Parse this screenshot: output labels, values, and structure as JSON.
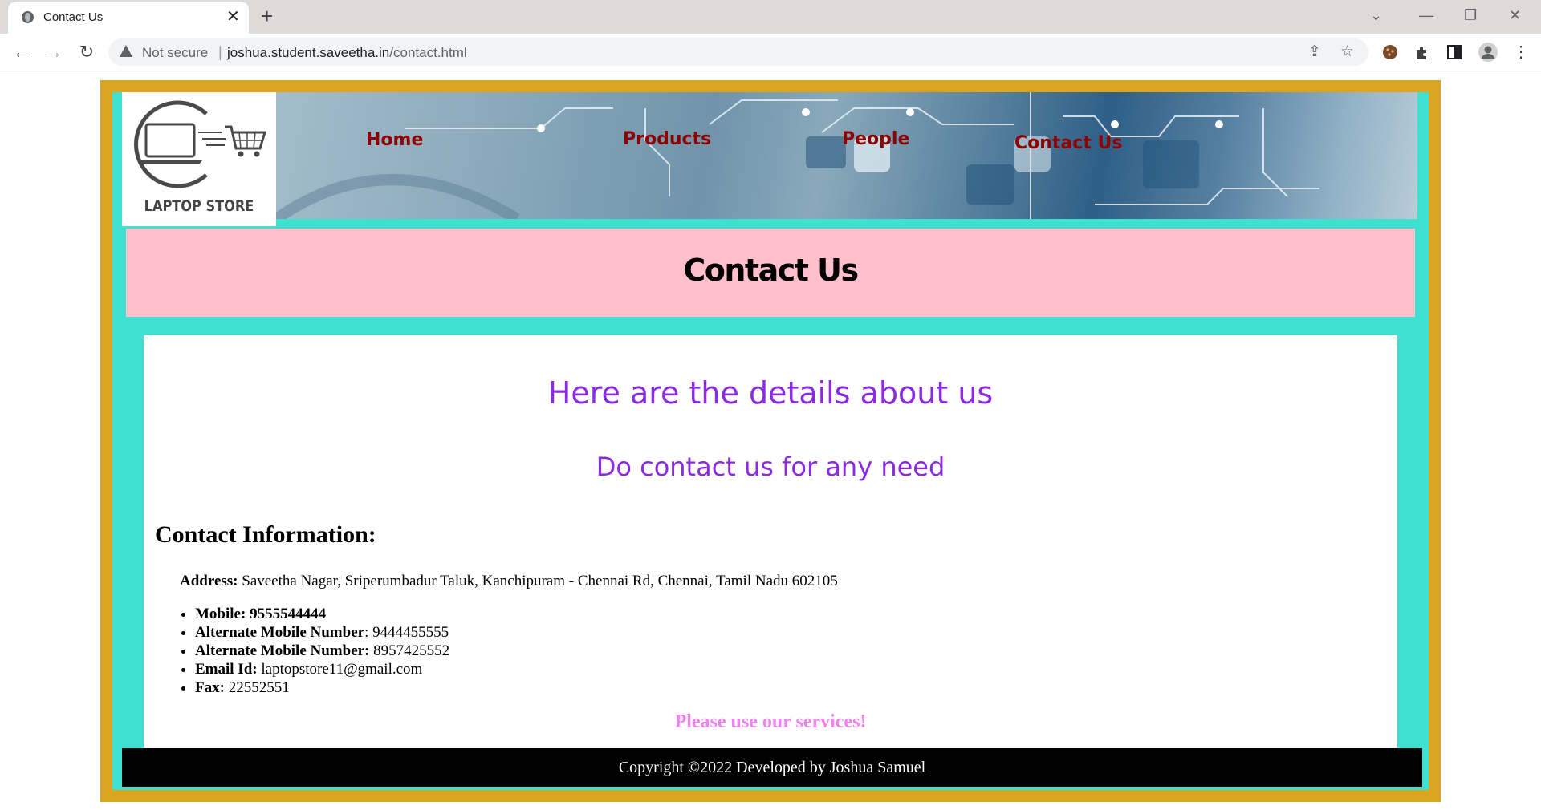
{
  "browser": {
    "tab_title": "Contact Us",
    "security_label": "Not secure",
    "url_host": "joshua.student.saveetha.in",
    "url_path": "/contact.html"
  },
  "site": {
    "logo_text": "LAPTOP STORE",
    "nav": [
      {
        "label": "Home"
      },
      {
        "label": "Products"
      },
      {
        "label": "People"
      },
      {
        "label": "Contact Us"
      }
    ],
    "page_title": "Contact Us",
    "heading": "Here are the details about us",
    "subheading": "Do contact us for any need",
    "contact_info_title": "Contact Information:",
    "address_label": "Address:",
    "address_value": " Saveetha Nagar, Sriperumbadur Taluk, Kanchipuram - Chennai Rd, Chennai, Tamil Nadu 602105",
    "contacts": [
      {
        "label": "Mobile: 9555544444",
        "value": ""
      },
      {
        "label": "Alternate Mobile Number",
        "value": ": 9444455555"
      },
      {
        "label": "Alternate Mobile Number:",
        "value": " 8957425552"
      },
      {
        "label": "Email Id:",
        "value": " laptopstore11@gmail.com"
      },
      {
        "label": "Fax:",
        "value": " 22552551"
      }
    ],
    "closing": "Please use our services!",
    "footer": "Copyright ©2022 Developed by Joshua Samuel"
  },
  "colors": {
    "frame": "#daa520",
    "inner": "#40e0d0",
    "title_band": "#ffc0cb",
    "heading": "#8a2be2",
    "nav_link": "#8b0000",
    "closing": "#ee82ee"
  }
}
